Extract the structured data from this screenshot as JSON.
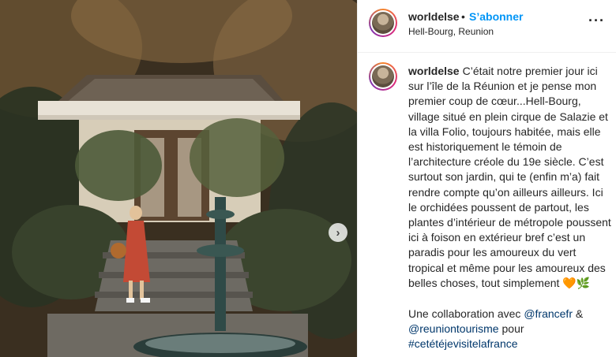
{
  "header": {
    "username": "worldelse",
    "separator": "•",
    "follow_label": "S’abonner",
    "location": "Hell-Bourg, Reunion",
    "more_icon": "more-options-icon",
    "more_label": "···"
  },
  "media": {
    "next_label": "›"
  },
  "caption": {
    "username": "worldelse",
    "text": "C’était notre premier jour ici sur l’île de la Réunion et je pense mon premier coup de cœur...Hell-Bourg, village situé en plein cirque de Salazie et la villa Folio, toujours habitée, mais elle est historiquement le témoin de l’architecture créole du 19e siècle. C’est surtout son jardin, qui te (enfin m’a) fait rendre compte qu’on ailleurs ailleurs. Ici le orchidées poussent de partout, les plantes d’intérieur de métropole poussent ici à foison en extérieur bref c’est un paradis pour les amoureux du vert tropical et même pour les amoureux des belles choses, tout simplement 🧡🌿",
    "collab_prefix": "Une collaboration avec ",
    "mention1": "@francefr",
    "collab_amp": " & ",
    "mention2": "@reuniontourisme",
    "collab_mid": " pour",
    "hashtag": "#cetétéjevisitelafrance"
  }
}
